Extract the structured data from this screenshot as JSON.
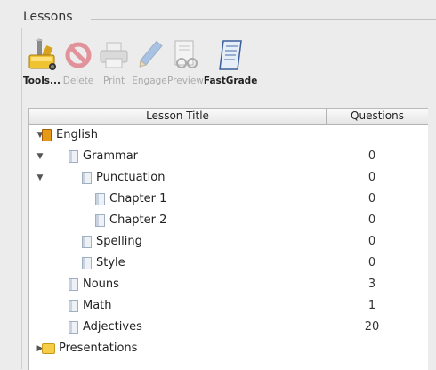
{
  "group": {
    "title": "Lessons"
  },
  "toolbar": {
    "tools": [
      {
        "id": "tools",
        "label": "Tools...",
        "icon": "tools-icon",
        "enabled": true
      },
      {
        "id": "delete",
        "label": "Delete",
        "icon": "delete-icon",
        "enabled": false
      },
      {
        "id": "print",
        "label": "Print",
        "icon": "printer-icon",
        "enabled": false
      },
      {
        "id": "engage",
        "label": "Engage",
        "icon": "pencil-icon",
        "enabled": false
      },
      {
        "id": "preview",
        "label": "Preview",
        "icon": "preview-icon",
        "enabled": false
      },
      {
        "id": "fastgrade",
        "label": "FastGrade",
        "icon": "fastgrade-icon",
        "enabled": true
      }
    ]
  },
  "tree": {
    "columns": {
      "title": "Lesson Title",
      "questions": "Questions"
    },
    "rows": [
      {
        "label": "English",
        "questions": "",
        "level": 0,
        "expander": "open",
        "icon": "book-icon"
      },
      {
        "label": "Grammar",
        "questions": "0",
        "level": 1,
        "expander": "open",
        "icon": "lesson-icon"
      },
      {
        "label": "Punctuation",
        "questions": "0",
        "level": 2,
        "expander": "open",
        "icon": "lesson-icon"
      },
      {
        "label": "Chapter 1",
        "questions": "0",
        "level": 3,
        "expander": "",
        "icon": "lesson-icon"
      },
      {
        "label": "Chapter 2",
        "questions": "0",
        "level": 3,
        "expander": "",
        "icon": "lesson-icon"
      },
      {
        "label": "Spelling",
        "questions": "0",
        "level": 2,
        "expander": "",
        "icon": "lesson-icon"
      },
      {
        "label": "Style",
        "questions": "0",
        "level": 2,
        "expander": "",
        "icon": "lesson-icon"
      },
      {
        "label": "Nouns",
        "questions": "3",
        "level": 1,
        "expander": "",
        "icon": "lesson-icon"
      },
      {
        "label": "Math",
        "questions": "1",
        "level": 1,
        "expander": "",
        "icon": "lesson-icon"
      },
      {
        "label": "Adjectives",
        "questions": "20",
        "level": 1,
        "expander": "",
        "icon": "lesson-icon"
      },
      {
        "label": "Presentations",
        "questions": "",
        "level": 0,
        "expander": "closed",
        "icon": "folder-icon"
      }
    ]
  },
  "colors": {
    "background": "#ececec",
    "disabled_text": "#aaaaaa",
    "folder": "#f7cc47",
    "book": "#e49a18"
  }
}
